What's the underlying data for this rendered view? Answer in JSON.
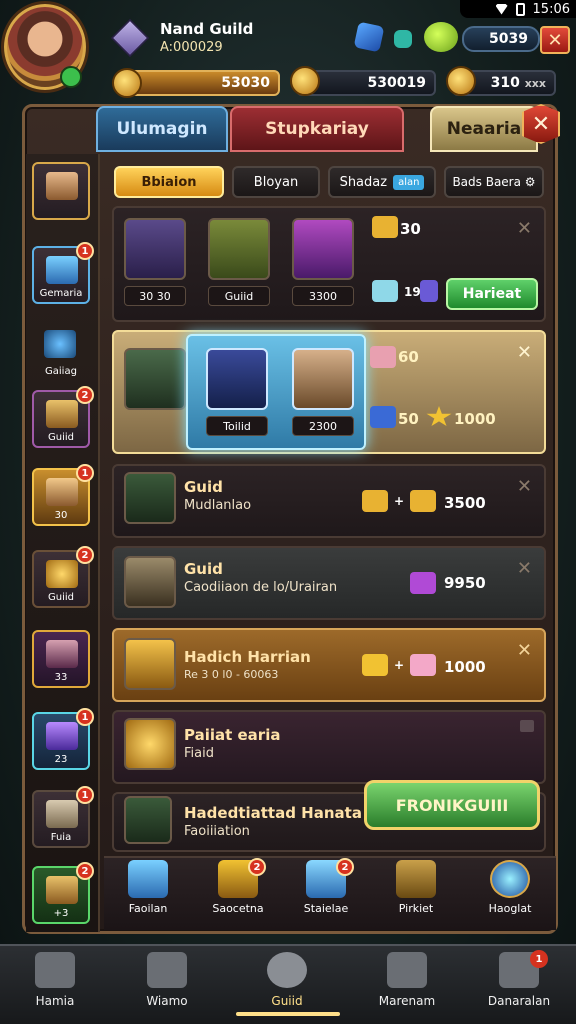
{
  "status_bar": {
    "time": "15:06"
  },
  "header": {
    "guild_name": "Nand Guild",
    "guild_id": "A:000029",
    "top_currency": "5039",
    "resource_1": "53030",
    "resource_2": "530019",
    "resource_3": "310",
    "resource_3_suffix": "xxx"
  },
  "tabs": {
    "tab1": "Ulumagin",
    "tab2": "Stupkariay",
    "tab3": "Neaaria"
  },
  "left_slots": [
    {
      "label": ""
    },
    {
      "label": "Gemaria",
      "badge": "1"
    },
    {
      "label": "Gaiiag"
    },
    {
      "label": "Guiid",
      "badge": "2"
    },
    {
      "label": "30",
      "badge": "1"
    },
    {
      "label": "Guiid",
      "badge": "2"
    },
    {
      "label": "33",
      "badge": ""
    },
    {
      "label": "23",
      "badge": "1"
    },
    {
      "label": "Fuia",
      "badge": "1"
    },
    {
      "label": "+3",
      "badge": "2"
    }
  ],
  "filters": {
    "f1": "Bbiaion",
    "f2": "Bloyan",
    "f3": "Shadaz",
    "f3_pill": "alan",
    "f4": "Bads Baera"
  },
  "rows": {
    "row1": {
      "tag1": "30 30",
      "tag2": "Guiid",
      "tag3": "3300",
      "reward": "30",
      "gem_text": "19",
      "claim": "Harieat"
    },
    "row2": {
      "tag1": "Toilid",
      "tag2": "2300",
      "reward1": "60",
      "reward2": "50",
      "reward3": "1000"
    },
    "row3": {
      "title": "Guid",
      "sub": "Mudlanlao",
      "value": "3500"
    },
    "row4": {
      "title": "Guid",
      "sub": "Caodiiaon de lo/Urairan",
      "value": "9950"
    },
    "row5": {
      "title": "Hadich Harrian",
      "sub": "Re 3 0 l0 - 60063",
      "value": "1000"
    },
    "row6": {
      "title": "Paiiat earia",
      "sub": "Fiaid"
    },
    "row7": {
      "title": "Hadedtiattad Hanata",
      "sub": "Faoiiiation"
    }
  },
  "join_button": "FRONIKGUIII",
  "icon_row": [
    {
      "label": "Faoilan"
    },
    {
      "label": "Saocetna",
      "badge": "2"
    },
    {
      "label": "Staielae",
      "badge": "2"
    },
    {
      "label": "Pirkiet"
    },
    {
      "label": "Haoglat"
    }
  ],
  "bottom_nav": [
    {
      "label": "Hamia"
    },
    {
      "label": "Wiamo"
    },
    {
      "label": "Guiid"
    },
    {
      "label": "Marenam"
    },
    {
      "label": "Danaralan",
      "badge": "1"
    }
  ]
}
